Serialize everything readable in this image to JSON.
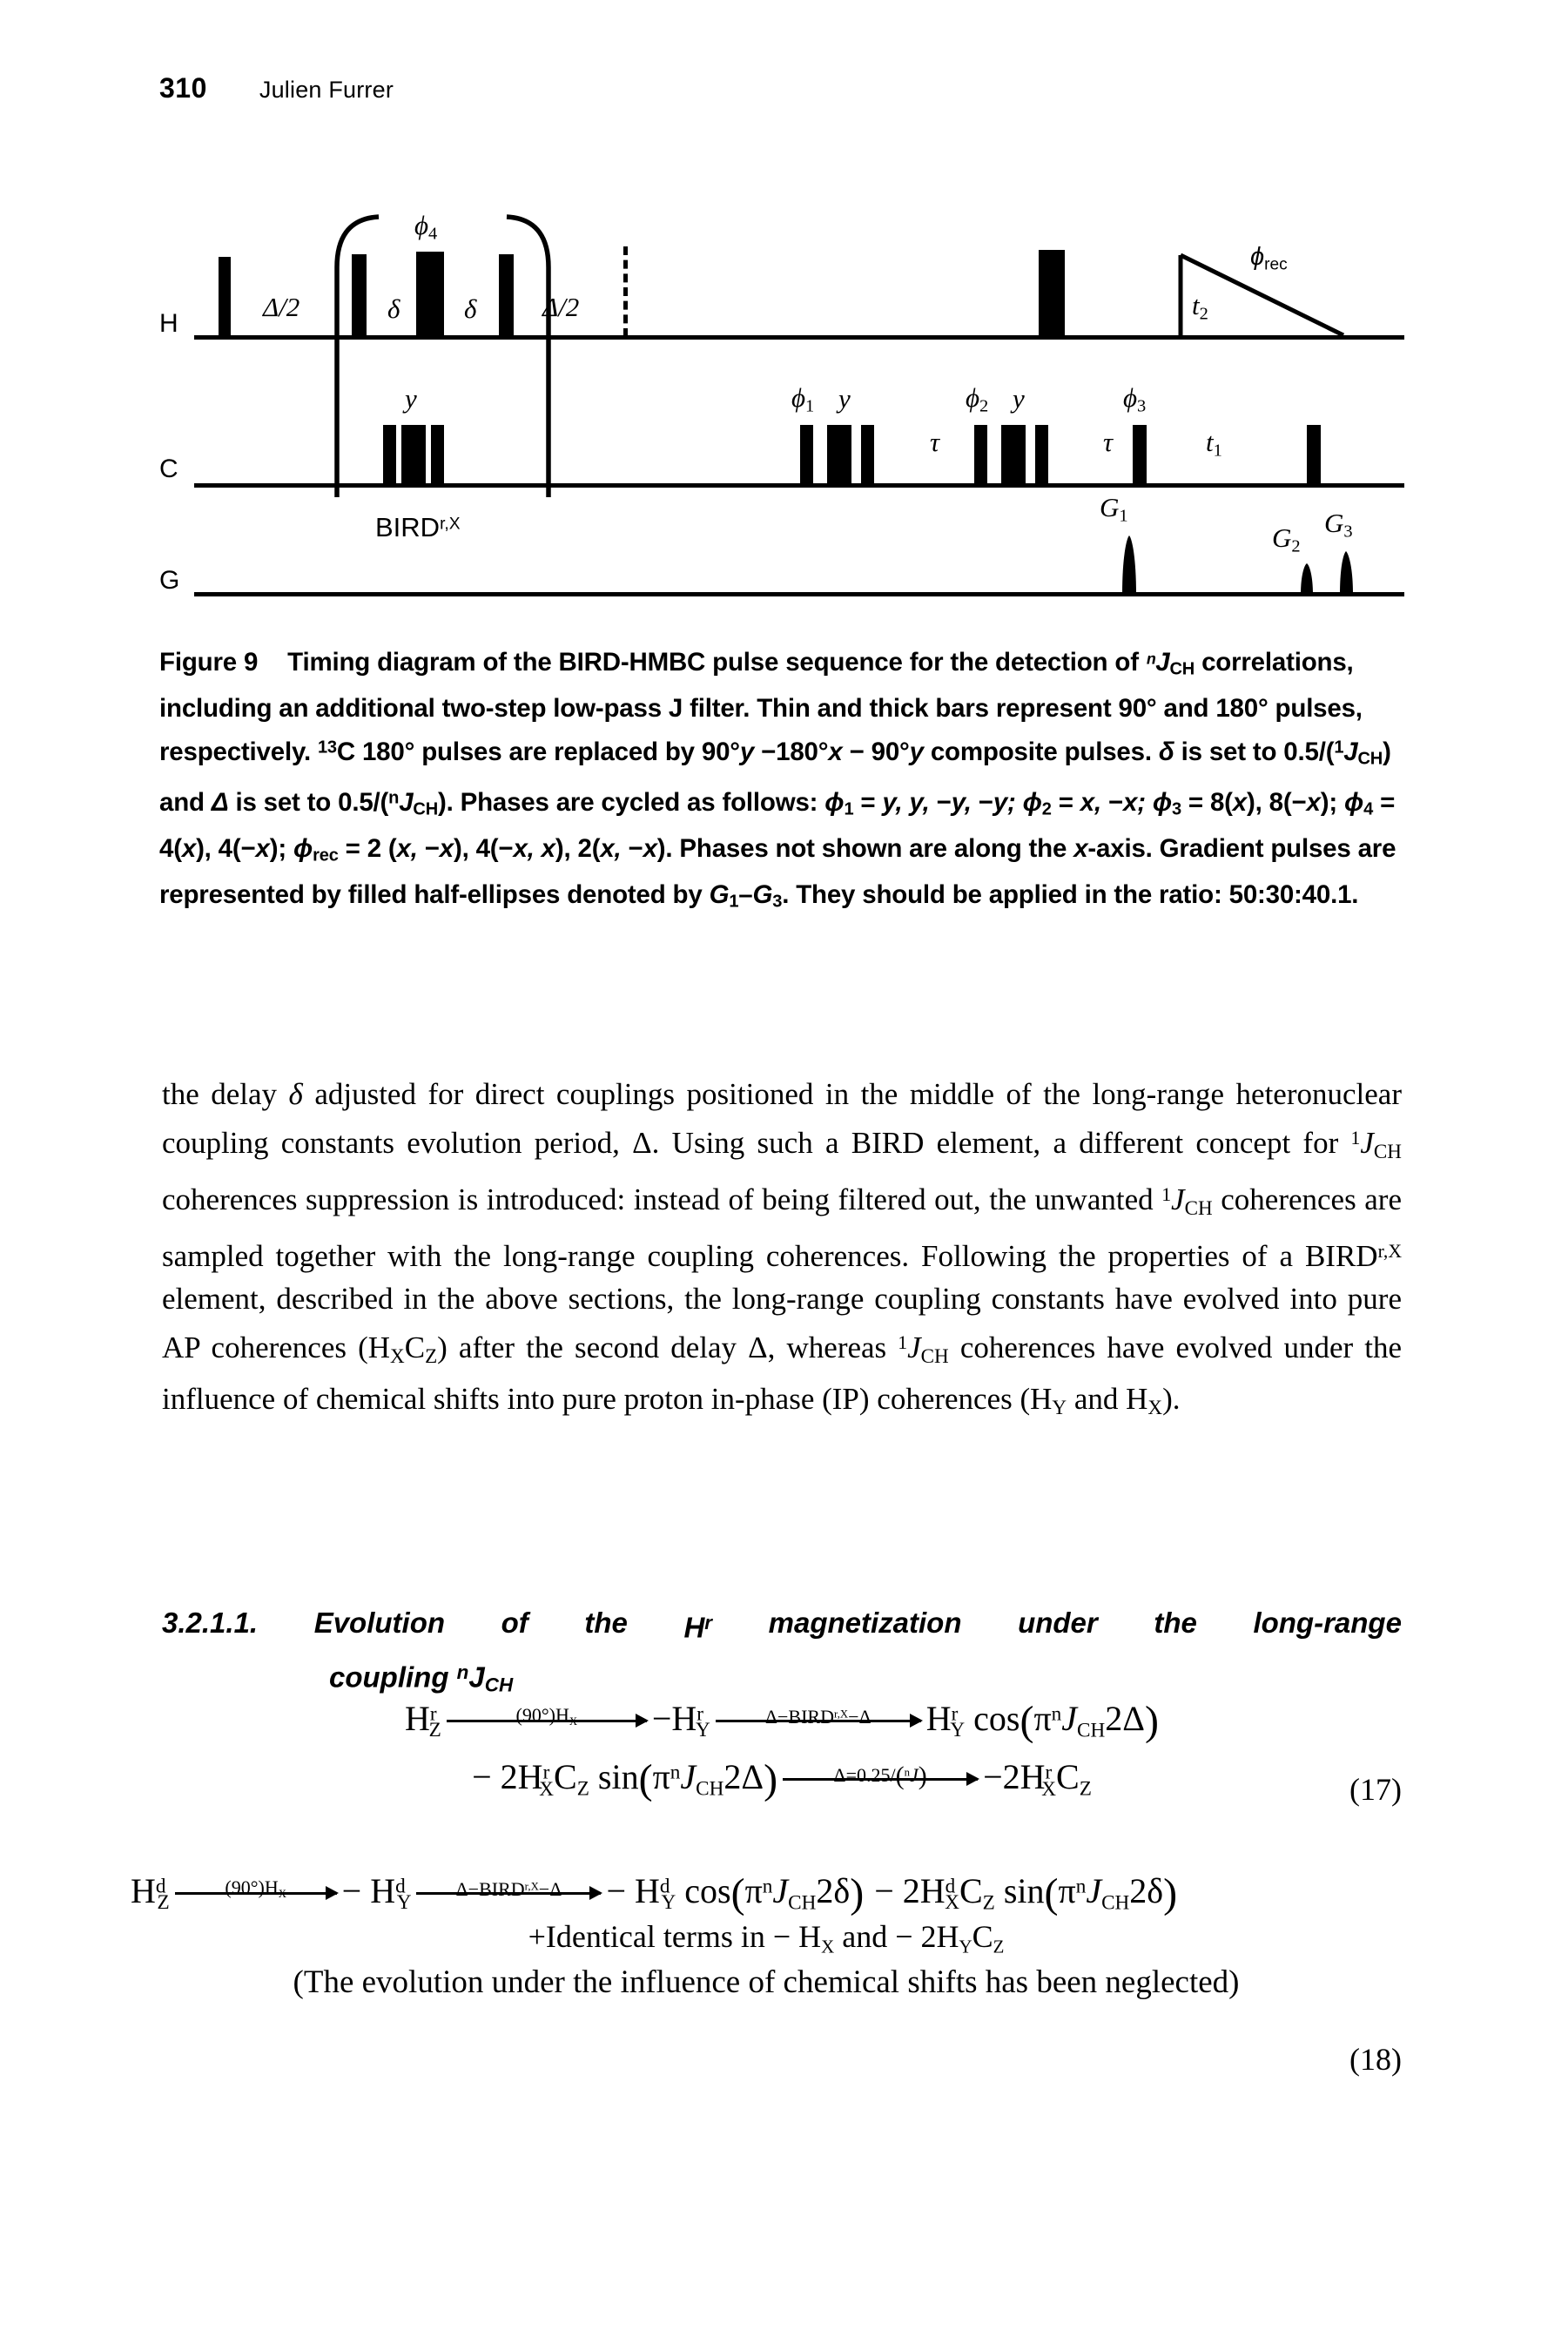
{
  "runhead": {
    "page_number": "310",
    "author": "Julien Furrer"
  },
  "figure": {
    "channels": [
      {
        "id": "H",
        "label": "H"
      },
      {
        "id": "C",
        "label": "C"
      },
      {
        "id": "G",
        "label": "G"
      }
    ],
    "h_channel": {
      "delay_first": "Δ/2",
      "delta_1": "δ",
      "delta_2": "δ",
      "delay_second": "Δ/2",
      "phase_180": "φ4",
      "acq_time": "t2",
      "acq_phase": "ϕrec"
    },
    "c_channel": {
      "bird_y": "y",
      "phase1": "φ1",
      "phase1_y": "y",
      "tau_1": "τ",
      "phase2": "φ2",
      "phase2_y": "y",
      "tau_2": "τ",
      "phase3": "φ3",
      "t1": "t1"
    },
    "bird_label": "BIRDr,X",
    "gradients": [
      {
        "label": "G1"
      },
      {
        "label": "G2"
      },
      {
        "label": "G3"
      }
    ]
  },
  "caption": {
    "title": "Figure 9",
    "text_html": "Timing diagram of the BIRD-HMBC pulse sequence for the detection of <i>ⁿ</i><i>J</i><span class=\"cap-sub\">CH</span> correlations, including an additional two-step low-pass J filter. Thin and thick bars represent 90° and 180° pulses, respectively. <span class=\"cap-sup\">13</span>C 180° pulses are replaced by 90°<i>y</i> −180°<i>x</i> − 90°<i>y</i> composite pulses. <i>δ</i> is set to 0.5/(<span class=\"cap-sup\">1</span><i>J</i><span class=\"cap-sub\">CH</span>) and <i>Δ</i> is set to 0.5/(<span class=\"cap-sup\">n</span><i>J</i><span class=\"cap-sub\">CH</span>). Phases are cycled as follows: <i>ϕ</i><span class=\"cap-sub\">1</span> = <i>y, y,</i> −<i>y,</i> −<i>y; ϕ</i><span class=\"cap-sub\">2</span> = <i>x,</i> −<i>x; ϕ</i><span class=\"cap-sub\">3</span> = 8(<i>x</i>), 8(−<i>x</i>); <i>ϕ</i><span class=\"cap-sub\">4</span> = 4(<i>x</i>), 4(−<i>x</i>); <i>ϕ</i><span class=\"cap-sub\">rec</span> = 2 (<i>x,</i> −<i>x</i>), 4(−<i>x, x</i>), 2(<i>x,</i> −<i>x</i>). Phases not shown are along the <i>x</i>-axis. Gradient pulses are represented by filled half-ellipses denoted by <i>G</i><span class=\"cap-sub\">1</span>–<i>G</i><span class=\"cap-sub\">3</span>. They should be applied in the ratio: 50:30:40.1."
  },
  "body": {
    "paragraph_html": "the delay <i>δ</i> adjusted for direct couplings positioned in the middle of the long-range heteronuclear coupling constants evolution period, Δ. Using such a BIRD element, a different concept for <span class=\"sup\">1</span><i>J</i><span class=\"sub\">CH</span> coherences suppression is introduced: instead of being filtered out, the unwanted <span class=\"sup\">1</span><i>J</i><span class=\"sub\">CH</span> coherences are sampled together with the long-range coupling coherences. Following the properties of a BIRD<span class=\"sup\">r,X</span> element, described in the above sections, the long-range coupling constants have evolved into pure AP coherences (H<span class=\"sub\">X</span>C<span class=\"sub\">Z</span>) after the second delay Δ, whereas <span class=\"sup\">1</span><i>J</i><span class=\"sub\">CH</span> coherences have evolved under the influence of chemical shifts into pure proton in-phase (IP) coherences (H<span class=\"sub\">Y</span> and H<span class=\"sub\">X</span>)."
  },
  "heading": {
    "number": "3.2.1.1.",
    "line1_words": [
      "Evolution",
      "of",
      "the",
      "Hʳ",
      "magnetization",
      "under",
      "the",
      "long-range"
    ],
    "line2_html": "coupling <span class=\"cap-sup\">n</span>J<span class=\"cap-sub\">CH</span>"
  },
  "equations": {
    "eq17": {
      "number": "(17)",
      "line1": {
        "start": "H",
        "start_sup": "r",
        "start_sub": "Z",
        "arrow1_top": "(90°)H",
        "arrow1_top_sub": "X",
        "mid": "−H",
        "mid_sup": "r",
        "mid_sub": "Y",
        "arrow2_top": "Δ−BIRD",
        "arrow2_top_sup": "r,X",
        "arrow2_top_tail": "−Δ",
        "end": "H",
        "end_sup": "r",
        "end_sub": "Y",
        "end_rest": "cos(πⁿJ",
        "end_rest_sub": "CH",
        "end_rest_tail": "2Δ)"
      },
      "line2": {
        "start": "− 2H",
        "start_sup": "r",
        "start_sub": "X",
        "start_tail": "C",
        "start_tail_sub": "Z",
        "start_fn": "sin(πⁿJ",
        "start_fn_sub": "CH",
        "start_fn_tail": "2Δ)",
        "arrow_top": "Δ=0.25/(ⁿJ)",
        "end": "−2H",
        "end_sup": "r",
        "end_sub": "X",
        "end_tail": "C",
        "end_tail_sub": "Z"
      }
    },
    "eq18": {
      "number": "(18)",
      "line1": {
        "start": "H",
        "start_sup": "d",
        "start_sub": "Z",
        "arrow1_top": "(90°)H",
        "arrow1_top_sub": "X",
        "mid": "− H",
        "mid_sup": "d",
        "mid_sub": "Y",
        "arrow2_top": "Δ−BIRD",
        "arrow2_top_sup": "r,X",
        "arrow2_top_tail": "−Δ",
        "end": "− H",
        "end_sup": "d",
        "end_sub": "Y",
        "end_rest": "cos(πⁿJ",
        "end_rest_sub": "CH",
        "end_rest_tail": "2δ)",
        "end2": "− 2H",
        "end2_sup": "d",
        "end2_sub": "X",
        "end2_tail": "C",
        "end2_tail_sub": "Z",
        "end2_fn": "sin(πⁿJ",
        "end2_fn_sub": "CH",
        "end2_fn_tail": "2δ)"
      },
      "line2_html": "+Identical terms in − H<span class=\"msub\">X</span> and − 2H<span class=\"msub\">Y</span>C<span class=\"msub\">Z</span>",
      "line3": "(The evolution under the influence of chemical shifts has been neglected)"
    }
  }
}
